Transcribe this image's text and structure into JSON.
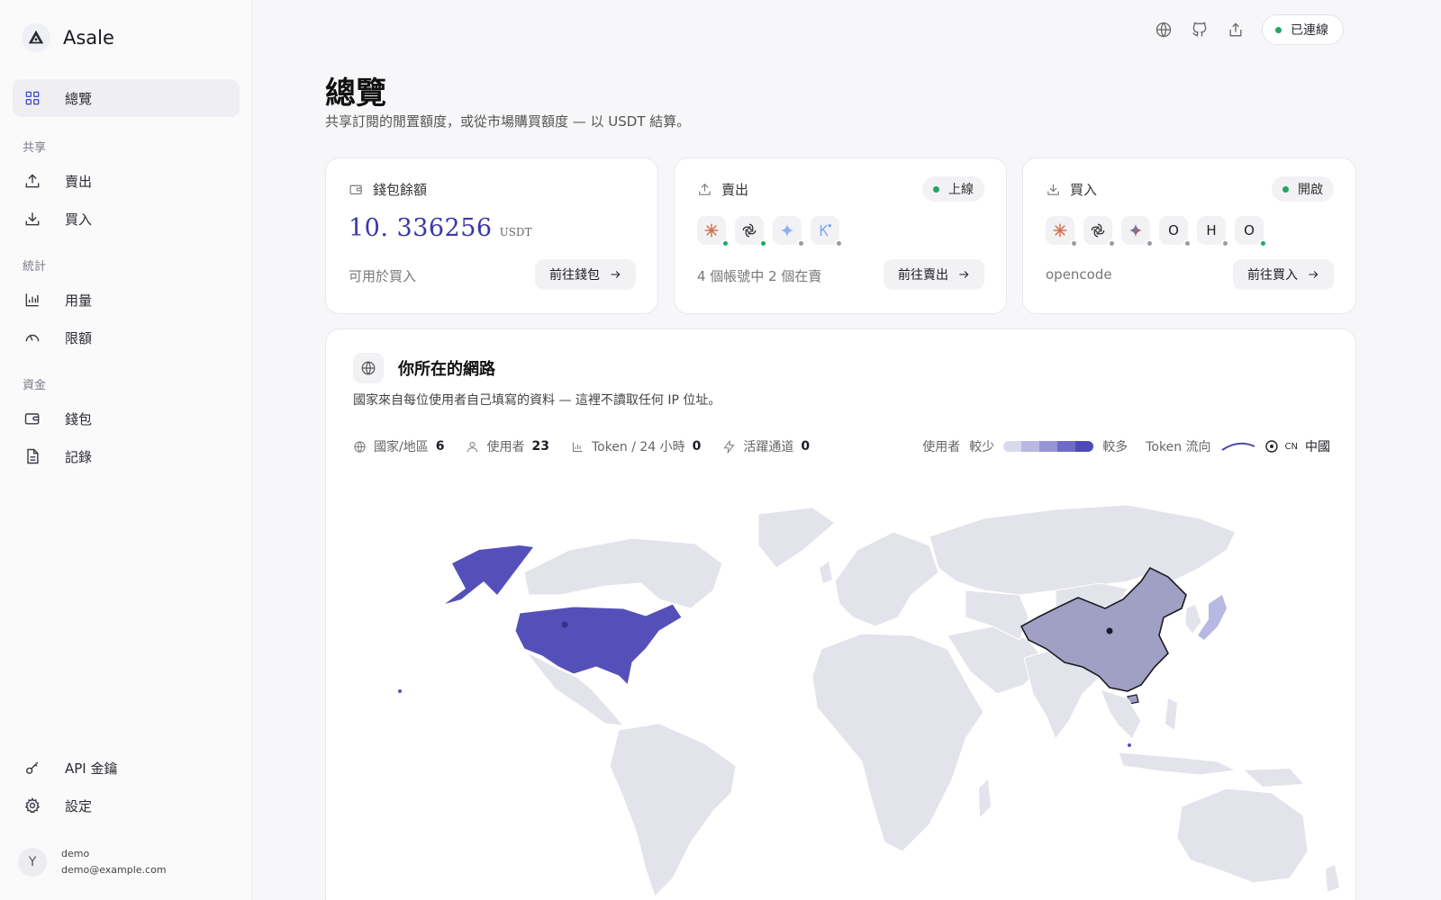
{
  "brand": {
    "name": "Asale"
  },
  "nav": {
    "overview": "總覽",
    "section_share": "共享",
    "sell": "賣出",
    "buy": "買入",
    "section_stats": "統計",
    "usage": "用量",
    "limits": "限額",
    "section_funds": "資金",
    "wallet": "錢包",
    "records": "記錄",
    "api_keys": "API 金鑰",
    "settings": "設定"
  },
  "user": {
    "avatar_letter": "Y",
    "name": "demo",
    "email": "demo@example.com"
  },
  "topbar": {
    "connection_label": "已連線"
  },
  "page": {
    "title": "總覽",
    "subtitle": "共享訂閱的閒置額度，或從市場購買額度 — 以 USDT 結算。"
  },
  "wallet_card": {
    "title": "錢包餘額",
    "balance": "10. 336256",
    "unit": "USDT",
    "foot": "可用於買入",
    "button": "前往錢包"
  },
  "sell_card": {
    "title": "賣出",
    "status": "上線",
    "foot": "4 個帳號中 2 個在賣",
    "button": "前往賣出",
    "providers": [
      {
        "icon": "claude-icon",
        "online": true
      },
      {
        "icon": "openai-icon",
        "online": true
      },
      {
        "icon": "gemini-icon",
        "online": false
      },
      {
        "icon": "kimi-icon",
        "online": false
      }
    ]
  },
  "buy_card": {
    "title": "買入",
    "status": "開啟",
    "foot": "opencode",
    "button": "前往買入",
    "providers": [
      {
        "icon": "claude-icon",
        "online": false
      },
      {
        "icon": "openai-icon",
        "online": false
      },
      {
        "icon": "gemini-icon",
        "online": false
      },
      {
        "icon": "letter-o-icon",
        "text": "O",
        "online": false
      },
      {
        "icon": "letter-h-icon",
        "text": "H",
        "online": false
      },
      {
        "icon": "letter-o-icon",
        "text": "O",
        "online": true
      }
    ]
  },
  "network": {
    "title": "你所在的網路",
    "subtitle": "國家來自每位使用者自己填寫的資料 — 這裡不讀取任何 IP 位址。",
    "stats": {
      "countries_label": "國家/地區",
      "countries_value": "6",
      "users_label": "使用者",
      "users_value": "23",
      "tokens_label": "Token / 24 小時",
      "tokens_value": "0",
      "channels_label": "活躍通道",
      "channels_value": "0"
    },
    "legend": {
      "users_label": "使用者",
      "less": "較少",
      "more": "較多",
      "flow_label": "Token 流向",
      "selected_code": "CN",
      "selected_name": "中國"
    }
  },
  "colors": {
    "accent": "#4b50c8",
    "online": "#1ea866",
    "map_land": "#e3e3ec",
    "map_high": "#5550b9",
    "map_selected": "#a09fc4"
  }
}
